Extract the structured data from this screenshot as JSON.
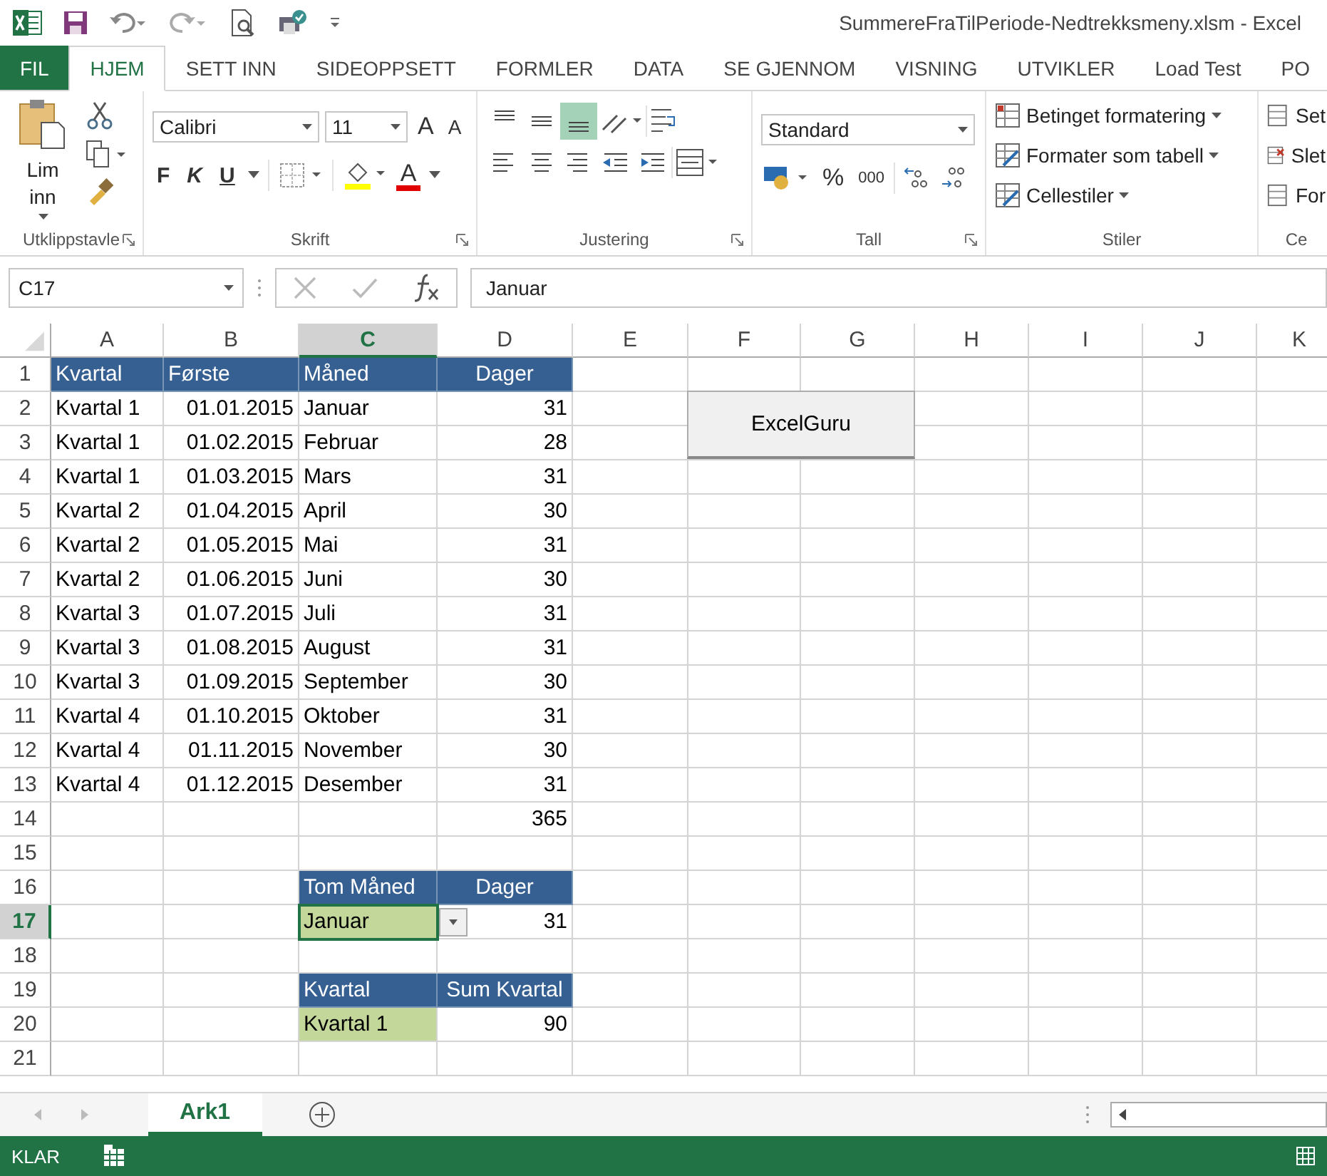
{
  "window": {
    "title": "SummereFraTilPeriode-Nedtrekksmeny.xlsm - Excel"
  },
  "tabs": [
    {
      "label": "FIL",
      "kind": "file",
      "selected": false
    },
    {
      "label": "HJEM",
      "kind": "tab",
      "selected": true
    },
    {
      "label": "SETT INN",
      "kind": "tab",
      "selected": false
    },
    {
      "label": "SIDEOPPSETT",
      "kind": "tab",
      "selected": false
    },
    {
      "label": "FORMLER",
      "kind": "tab",
      "selected": false
    },
    {
      "label": "DATA",
      "kind": "tab",
      "selected": false
    },
    {
      "label": "SE GJENNOM",
      "kind": "tab",
      "selected": false
    },
    {
      "label": "VISNING",
      "kind": "tab",
      "selected": false
    },
    {
      "label": "UTVIKLER",
      "kind": "tab",
      "selected": false
    },
    {
      "label": "Load Test",
      "kind": "tab",
      "selected": false
    },
    {
      "label": "PO",
      "kind": "tab",
      "selected": false
    }
  ],
  "ribbon": {
    "groups": [
      {
        "kind": "clipboard",
        "label": "Utklippstavle",
        "launcher": true,
        "paste_label": "Lim inn"
      },
      {
        "kind": "font",
        "label": "Skrift",
        "launcher": true,
        "font": "Calibri",
        "size": "11",
        "size_buttons": [
          "A",
          "A"
        ],
        "style_buttons": [
          "F",
          "K",
          "U"
        ],
        "font_color_button": "A"
      },
      {
        "kind": "alignment",
        "label": "Justering",
        "launcher": true,
        "vertical_align": [
          {
            "selected": false
          },
          {
            "selected": false
          },
          {
            "selected": true
          }
        ]
      },
      {
        "kind": "number",
        "label": "Tall",
        "launcher": true,
        "format": "Standard",
        "percent": "%",
        "thousands": "000"
      },
      {
        "kind": "styles",
        "label": "Stiler",
        "launcher": false,
        "items": [
          "Betinget formatering",
          "Formater som tabell",
          "Cellestiler"
        ]
      },
      {
        "kind": "cells",
        "label": "Ce",
        "launcher": false,
        "items": [
          "Set",
          "Slet",
          "For"
        ]
      }
    ]
  },
  "formula_bar": {
    "name_box": "C17",
    "formula": "Januar"
  },
  "sheet": {
    "columns": [
      {
        "label": "A",
        "selected": false
      },
      {
        "label": "B",
        "selected": false
      },
      {
        "label": "C",
        "selected": true
      },
      {
        "label": "D",
        "selected": false
      },
      {
        "label": "E",
        "selected": false
      },
      {
        "label": "F",
        "selected": false
      },
      {
        "label": "G",
        "selected": false
      },
      {
        "label": "H",
        "selected": false
      },
      {
        "label": "I",
        "selected": false
      },
      {
        "label": "J",
        "selected": false
      },
      {
        "label": "K",
        "selected": false
      }
    ],
    "rows": [
      {
        "label": "1",
        "selected": false,
        "cells": [
          {
            "text": "Kvartal",
            "kind": "header"
          },
          {
            "text": "Første",
            "kind": "header"
          },
          {
            "text": "Måned",
            "kind": "header"
          },
          {
            "text": "Dager",
            "kind": "header-center"
          }
        ]
      },
      {
        "label": "2",
        "selected": false,
        "cells": [
          {
            "text": "Kvartal 1",
            "kind": "text"
          },
          {
            "text": "01.01.2015",
            "kind": "number"
          },
          {
            "text": "Januar",
            "kind": "text"
          },
          {
            "text": "31",
            "kind": "number"
          }
        ]
      },
      {
        "label": "3",
        "selected": false,
        "cells": [
          {
            "text": "Kvartal 1",
            "kind": "text"
          },
          {
            "text": "01.02.2015",
            "kind": "number"
          },
          {
            "text": "Februar",
            "kind": "text"
          },
          {
            "text": "28",
            "kind": "number"
          }
        ]
      },
      {
        "label": "4",
        "selected": false,
        "cells": [
          {
            "text": "Kvartal 1",
            "kind": "text"
          },
          {
            "text": "01.03.2015",
            "kind": "number"
          },
          {
            "text": "Mars",
            "kind": "text"
          },
          {
            "text": "31",
            "kind": "number"
          }
        ]
      },
      {
        "label": "5",
        "selected": false,
        "cells": [
          {
            "text": "Kvartal 2",
            "kind": "text"
          },
          {
            "text": "01.04.2015",
            "kind": "number"
          },
          {
            "text": "April",
            "kind": "text"
          },
          {
            "text": "30",
            "kind": "number"
          }
        ]
      },
      {
        "label": "6",
        "selected": false,
        "cells": [
          {
            "text": "Kvartal 2",
            "kind": "text"
          },
          {
            "text": "01.05.2015",
            "kind": "number"
          },
          {
            "text": "Mai",
            "kind": "text"
          },
          {
            "text": "31",
            "kind": "number"
          }
        ]
      },
      {
        "label": "7",
        "selected": false,
        "cells": [
          {
            "text": "Kvartal 2",
            "kind": "text"
          },
          {
            "text": "01.06.2015",
            "kind": "number"
          },
          {
            "text": "Juni",
            "kind": "text"
          },
          {
            "text": "30",
            "kind": "number"
          }
        ]
      },
      {
        "label": "8",
        "selected": false,
        "cells": [
          {
            "text": "Kvartal 3",
            "kind": "text"
          },
          {
            "text": "01.07.2015",
            "kind": "number"
          },
          {
            "text": "Juli",
            "kind": "text"
          },
          {
            "text": "31",
            "kind": "number"
          }
        ]
      },
      {
        "label": "9",
        "selected": false,
        "cells": [
          {
            "text": "Kvartal 3",
            "kind": "text"
          },
          {
            "text": "01.08.2015",
            "kind": "number"
          },
          {
            "text": "August",
            "kind": "text"
          },
          {
            "text": "31",
            "kind": "number"
          }
        ]
      },
      {
        "label": "10",
        "selected": false,
        "cells": [
          {
            "text": "Kvartal 3",
            "kind": "text"
          },
          {
            "text": "01.09.2015",
            "kind": "number"
          },
          {
            "text": "September",
            "kind": "text"
          },
          {
            "text": "30",
            "kind": "number"
          }
        ]
      },
      {
        "label": "11",
        "selected": false,
        "cells": [
          {
            "text": "Kvartal 4",
            "kind": "text"
          },
          {
            "text": "01.10.2015",
            "kind": "number"
          },
          {
            "text": "Oktober",
            "kind": "text"
          },
          {
            "text": "31",
            "kind": "number"
          }
        ]
      },
      {
        "label": "12",
        "selected": false,
        "cells": [
          {
            "text": "Kvartal 4",
            "kind": "text"
          },
          {
            "text": "01.11.2015",
            "kind": "number"
          },
          {
            "text": "November",
            "kind": "text"
          },
          {
            "text": "30",
            "kind": "number"
          }
        ]
      },
      {
        "label": "13",
        "selected": false,
        "cells": [
          {
            "text": "Kvartal 4",
            "kind": "text"
          },
          {
            "text": "01.12.2015",
            "kind": "number"
          },
          {
            "text": "Desember",
            "kind": "text"
          },
          {
            "text": "31",
            "kind": "number"
          }
        ]
      },
      {
        "label": "14",
        "selected": false,
        "cells": [
          null,
          null,
          null,
          {
            "text": "365",
            "kind": "number"
          }
        ]
      },
      {
        "label": "15",
        "selected": false,
        "cells": []
      },
      {
        "label": "16",
        "selected": false,
        "cells": [
          null,
          null,
          {
            "text": "Tom Måned",
            "kind": "header"
          },
          {
            "text": "Dager",
            "kind": "header-center"
          }
        ]
      },
      {
        "label": "17",
        "selected": true,
        "cells": [
          null,
          null,
          {
            "text": "Januar",
            "kind": "input",
            "active": true,
            "dropdown": true
          },
          {
            "text": "31",
            "kind": "number"
          }
        ]
      },
      {
        "label": "18",
        "selected": false,
        "cells": []
      },
      {
        "label": "19",
        "selected": false,
        "cells": [
          null,
          null,
          {
            "text": "Kvartal",
            "kind": "header"
          },
          {
            "text": "Sum Kvartal",
            "kind": "header-center"
          }
        ]
      },
      {
        "label": "20",
        "selected": false,
        "cells": [
          null,
          null,
          {
            "text": "Kvartal 1",
            "kind": "input"
          },
          {
            "text": "90",
            "kind": "number"
          }
        ]
      },
      {
        "label": "21",
        "selected": false,
        "cells": []
      }
    ],
    "button": {
      "label": "ExcelGuru"
    }
  },
  "sheet_tabs": [
    {
      "label": "Ark1",
      "selected": true
    }
  ],
  "status_bar": {
    "status": "KLAR"
  }
}
